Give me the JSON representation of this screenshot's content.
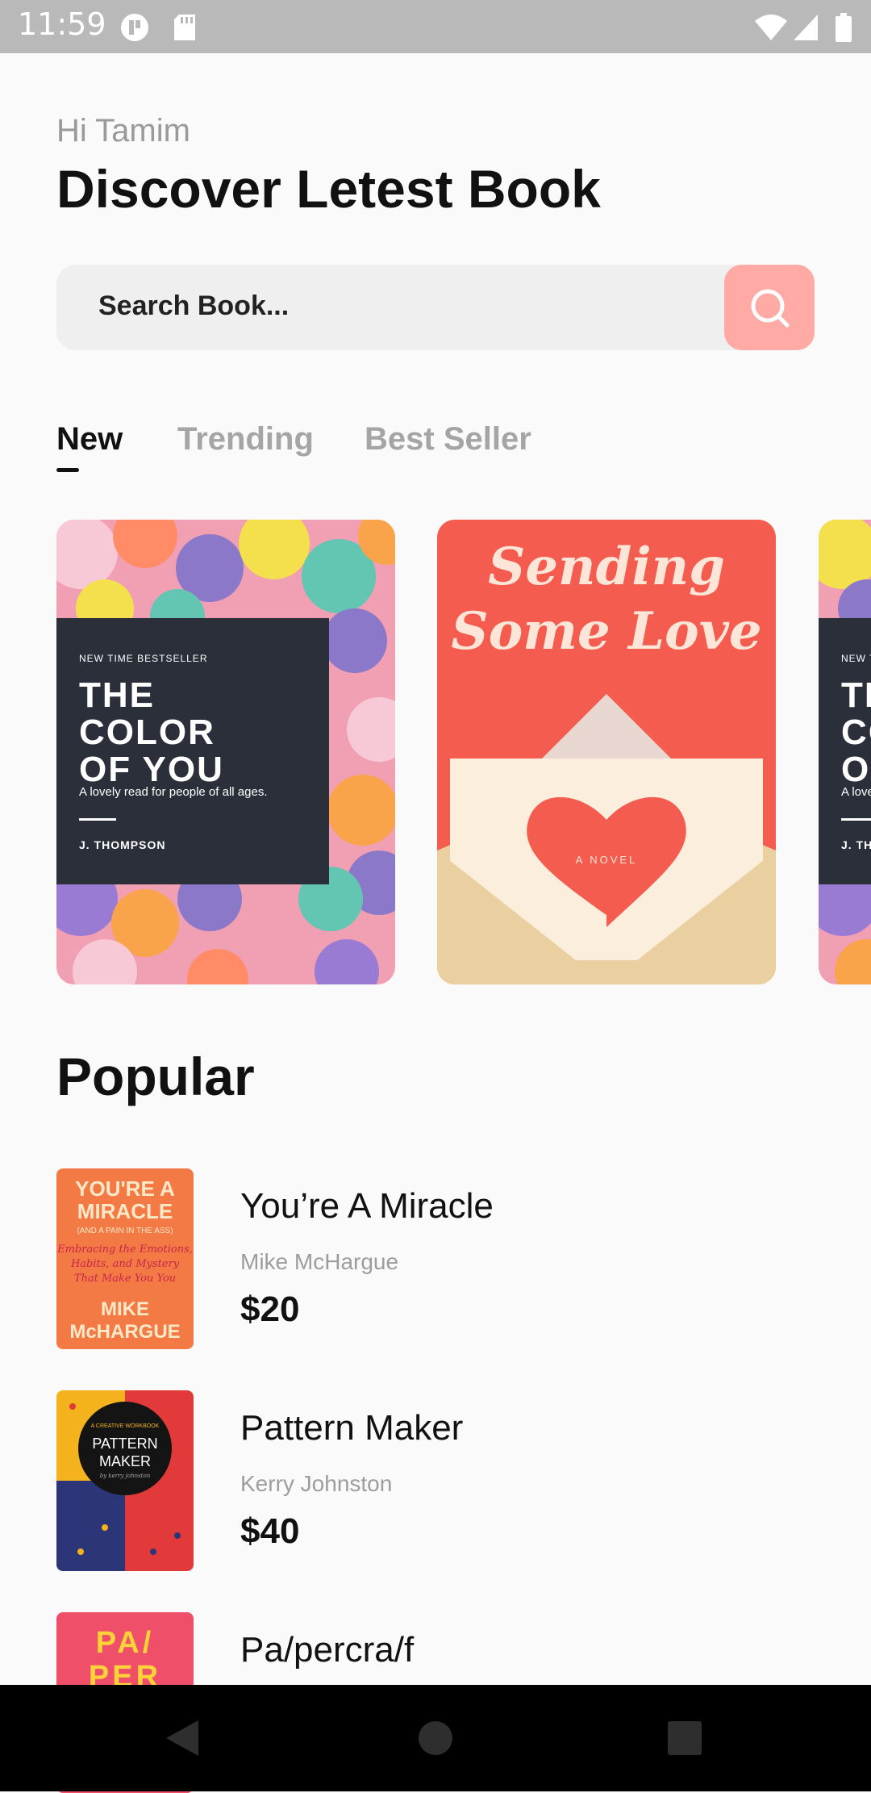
{
  "status_bar": {
    "time": "11:59",
    "icons": [
      "cast-icon",
      "sd-card-icon",
      "wifi-icon",
      "signal-icon",
      "battery-icon"
    ]
  },
  "header": {
    "greeting": "Hi Tamim",
    "title": "Discover Letest Book"
  },
  "search": {
    "placeholder": "Search Book...",
    "icon": "search-icon"
  },
  "tabs": [
    {
      "label": "New",
      "active": true
    },
    {
      "label": "Trending",
      "active": false
    },
    {
      "label": "Best Seller",
      "active": false
    }
  ],
  "featured_books": [
    {
      "kicker": "NEW TIME BESTSELLER",
      "title_lines": [
        "THE",
        "COLOR",
        "OF YOU"
      ],
      "tagline": "A lovely read for people of all ages.",
      "author": "J. THOMPSON"
    },
    {
      "title_lines": [
        "Sending",
        "Some Love"
      ],
      "subtitle": "A NOVEL"
    },
    {
      "kicker": "NEW TIME BESTSELLER",
      "title_lines": [
        "TH",
        "CO",
        "OF"
      ],
      "tagline": "A lovely",
      "author": "J. TH"
    }
  ],
  "popular": {
    "title": "Popular",
    "items": [
      {
        "title": "You’re A Miracle",
        "author": "Mike McHargue",
        "price": "$20",
        "cover": {
          "line1": "YOU'RE A",
          "line2": "MIRACLE",
          "sub": "(AND A PAIN IN THE ASS)",
          "tag1": "Embracing the Emotions,",
          "tag2": "Habits, and Mystery",
          "tag3": "That Make You You",
          "author1": "MIKE",
          "author2": "McHARGUE"
        }
      },
      {
        "title": "Pattern Maker",
        "author": "Kerry Johnston",
        "price": "$40",
        "cover": {
          "kicker": "A CREATIVE WORKBOOK",
          "line1": "PATTERN",
          "line2": "MAKER",
          "author": "by kerry johnston"
        }
      },
      {
        "title": "Pa/percra/f",
        "cover": {
          "line1": "PA/",
          "line2": "PER"
        }
      }
    ]
  },
  "colors": {
    "accent": "#ffaaa5",
    "text": "#111111",
    "muted": "#9d9d9d",
    "background": "#fafafa"
  },
  "nav_bar": {
    "icons": [
      "back-icon",
      "home-icon",
      "recents-icon"
    ]
  }
}
